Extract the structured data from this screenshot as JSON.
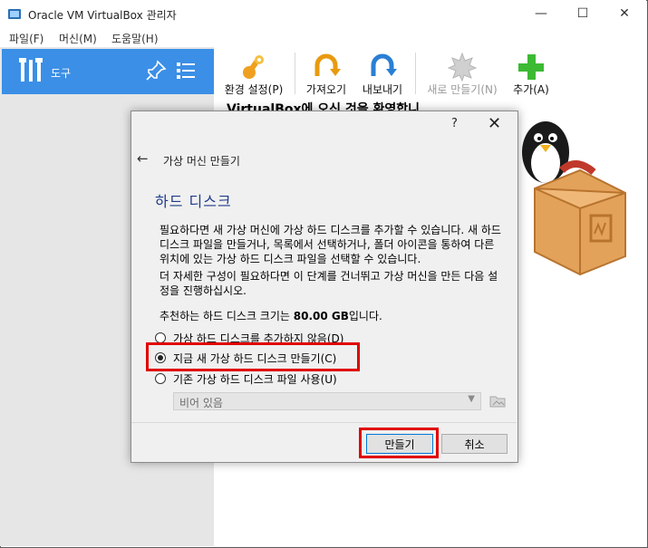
{
  "window": {
    "title": "Oracle VM VirtualBox 관리자",
    "minimize": "—",
    "maximize": "☐",
    "close": "✕"
  },
  "menu": [
    "파일(F)",
    "머신(M)",
    "도움말(H)"
  ],
  "sidebar": {
    "tools_label": "도구"
  },
  "toolbar": {
    "items": [
      {
        "label": "환경 설정(P)",
        "icon": "settings-icon",
        "enabled": true
      },
      {
        "label": "가져오기",
        "icon": "import-icon",
        "enabled": true
      },
      {
        "label": "내보내기",
        "icon": "export-icon",
        "enabled": true
      },
      {
        "label": "새로 만들기(N)",
        "icon": "new-icon",
        "enabled": false
      },
      {
        "label": "추가(A)",
        "icon": "add-icon",
        "enabled": true
      }
    ]
  },
  "welcome": {
    "text": "VirtualBox에 오신 것을 환영합니"
  },
  "dialog": {
    "help": "?",
    "close": "✕",
    "back": "←",
    "title": "가상 머신 만들기",
    "heading": "하드 디스크",
    "para1": "필요하다면 새 가상 머신에 가상 하드 디스크를 추가할 수 있습니다. 새 하드 디스크 파일을 만들거나, 목록에서 선택하거나, 폴더 아이콘을 통하여 다른 위치에 있는 가상 하드 디스크 파일을 선택할 수 있습니다.",
    "para2": "더 자세한 구성이 필요하다면 이 단계를 건너뛰고 가상 머신을 만든 다음 설정을 진행하십시오.",
    "para3_prefix": "추천하는 하드 디스크 크기는 ",
    "para3_size": "80.00 GB",
    "para3_suffix": "입니다.",
    "options": [
      {
        "label": "가상 하드 디스크를 추가하지 않음(D)",
        "selected": false
      },
      {
        "label": "지금 새 가상 하드 디스크 만들기(C)",
        "selected": true
      },
      {
        "label": "기존 가상 하드 디스크 파일 사용(U)",
        "selected": false
      }
    ],
    "file_select_value": "비어 있음",
    "create_label": "만들기",
    "cancel_label": "취소"
  },
  "colors": {
    "accent": "#3b8fe6",
    "highlight": "#e00000"
  }
}
